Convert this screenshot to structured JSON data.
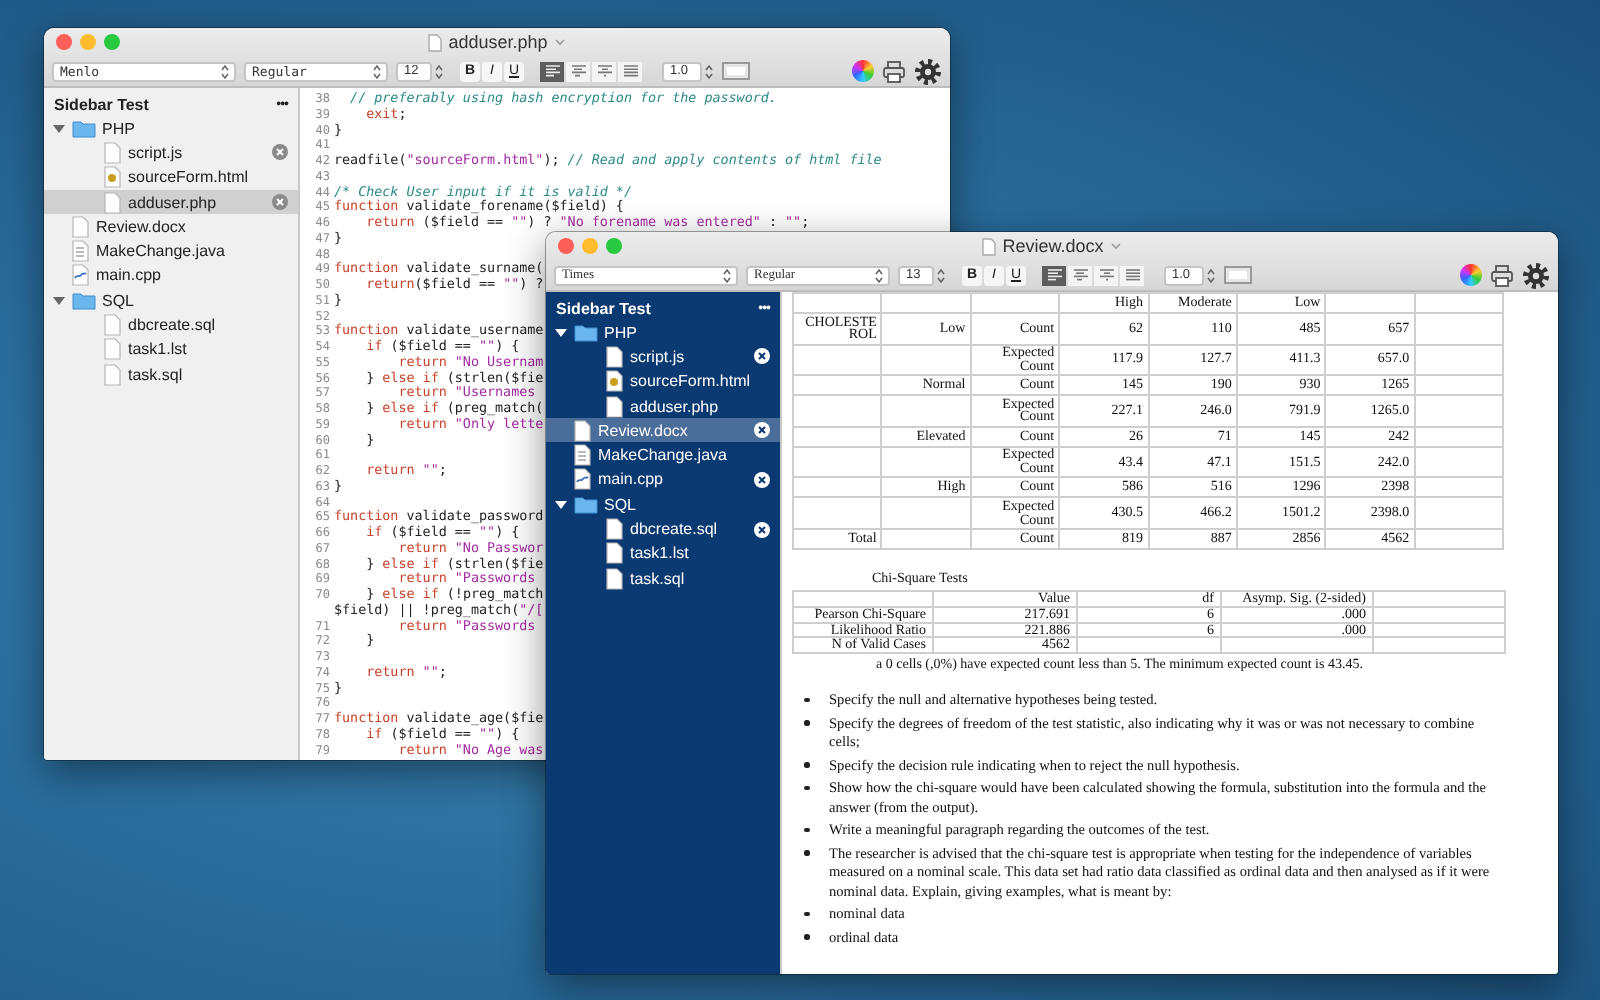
{
  "windows": [
    {
      "kind": "code",
      "title": "adduser.php",
      "toolbar": {
        "font": "Menlo",
        "style": "Regular",
        "size": "12",
        "format_buttons": [
          {
            "kind": "bold",
            "label": "B"
          },
          {
            "kind": "italic",
            "label": "I"
          },
          {
            "kind": "underline",
            "label": "U"
          }
        ],
        "align_buttons": [
          {
            "kind": "left",
            "selected": true
          },
          {
            "kind": "center",
            "selected": false
          },
          {
            "kind": "right",
            "selected": false
          },
          {
            "kind": "justify",
            "selected": false
          }
        ],
        "line_spacing": "1.0"
      },
      "sidebar": {
        "dark": false,
        "title": "Sidebar Test",
        "menu": "•••",
        "items": [
          {
            "name": "PHP",
            "kind": "folder",
            "expanded": true,
            "selected": false,
            "children": [
              {
                "name": "script.js",
                "kind": "file",
                "open": true,
                "selected": false
              },
              {
                "name": "sourceForm.html",
                "kind": "html",
                "open": false,
                "selected": false
              },
              {
                "name": "adduser.php",
                "kind": "file",
                "open": true,
                "selected": true
              }
            ]
          },
          {
            "name": "Review.docx",
            "kind": "file",
            "open": false,
            "selected": false
          },
          {
            "name": "MakeChange.java",
            "kind": "java",
            "open": false,
            "selected": false
          },
          {
            "name": "main.cpp",
            "kind": "cpp",
            "open": false,
            "selected": false
          },
          {
            "name": "SQL",
            "kind": "folder",
            "expanded": true,
            "selected": false,
            "children": [
              {
                "name": "dbcreate.sql",
                "kind": "file",
                "open": false,
                "selected": false
              },
              {
                "name": "task1.lst",
                "kind": "file",
                "open": false,
                "selected": false
              },
              {
                "name": "task.sql",
                "kind": "file",
                "open": false,
                "selected": false
              }
            ]
          }
        ]
      },
      "code": [
        {
          "number": "38",
          "tokens": [
            {
              "kind": "comment",
              "text": "  // preferably using hash encryption for the password."
            }
          ]
        },
        {
          "number": "39",
          "tokens": [
            {
              "kind": "keyword",
              "text": "    exit"
            },
            {
              "kind": "plain",
              "text": ";"
            }
          ]
        },
        {
          "number": "40",
          "tokens": [
            {
              "kind": "plain",
              "text": "}"
            }
          ]
        },
        {
          "number": "41"
        },
        {
          "number": "42",
          "tokens": [
            {
              "kind": "plain",
              "text": "readfile("
            },
            {
              "kind": "string",
              "text": "\"sourceForm.html\""
            },
            {
              "kind": "plain",
              "text": "); "
            },
            {
              "kind": "comment",
              "text": "// Read and apply contents of html file"
            }
          ]
        },
        {
          "number": "43"
        },
        {
          "number": "44",
          "tokens": [
            {
              "kind": "comment",
              "text": "/* Check User input if it is valid */"
            }
          ]
        },
        {
          "number": "45",
          "tokens": [
            {
              "kind": "keyword",
              "text": "function"
            },
            {
              "kind": "plain",
              "text": " validate_forename($field) {"
            }
          ]
        },
        {
          "number": "46",
          "tokens": [
            {
              "kind": "keyword",
              "text": "    return"
            },
            {
              "kind": "plain",
              "text": " ($field == "
            },
            {
              "kind": "string",
              "text": "\"\""
            },
            {
              "kind": "plain",
              "text": ") ? "
            },
            {
              "kind": "string",
              "text": "\"No forename was entered\""
            },
            {
              "kind": "plain",
              "text": " : "
            },
            {
              "kind": "string",
              "text": "\"\""
            },
            {
              "kind": "plain",
              "text": ";"
            }
          ]
        },
        {
          "number": "47",
          "tokens": [
            {
              "kind": "plain",
              "text": "}"
            }
          ]
        },
        {
          "number": "48"
        },
        {
          "number": "49",
          "tokens": [
            {
              "kind": "keyword",
              "text": "function"
            },
            {
              "kind": "plain",
              "text": " validate_surname("
            }
          ]
        },
        {
          "number": "50",
          "tokens": [
            {
              "kind": "keyword",
              "text": "    return"
            },
            {
              "kind": "plain",
              "text": "($field == "
            },
            {
              "kind": "string",
              "text": "\"\""
            },
            {
              "kind": "plain",
              "text": ") ?"
            }
          ]
        },
        {
          "number": "51",
          "tokens": [
            {
              "kind": "plain",
              "text": "}"
            }
          ]
        },
        {
          "number": "52"
        },
        {
          "number": "53",
          "tokens": [
            {
              "kind": "keyword",
              "text": "function"
            },
            {
              "kind": "plain",
              "text": " validate_username"
            }
          ]
        },
        {
          "number": "54",
          "tokens": [
            {
              "kind": "keyword",
              "text": "    if"
            },
            {
              "kind": "plain",
              "text": " ($field == "
            },
            {
              "kind": "string",
              "text": "\"\""
            },
            {
              "kind": "plain",
              "text": ") {"
            }
          ]
        },
        {
          "number": "55",
          "tokens": [
            {
              "kind": "keyword",
              "text": "        return"
            },
            {
              "kind": "string",
              "text": " \"No Usernam"
            }
          ]
        },
        {
          "number": "56",
          "tokens": [
            {
              "kind": "plain",
              "text": "    } "
            },
            {
              "kind": "keyword",
              "text": "else if"
            },
            {
              "kind": "plain",
              "text": " (strlen($fie"
            }
          ]
        },
        {
          "number": "57",
          "tokens": [
            {
              "kind": "keyword",
              "text": "        return"
            },
            {
              "kind": "string",
              "text": " \"Usernames"
            }
          ]
        },
        {
          "number": "58",
          "tokens": [
            {
              "kind": "plain",
              "text": "    } "
            },
            {
              "kind": "keyword",
              "text": "else if"
            },
            {
              "kind": "plain",
              "text": " (preg_match("
            }
          ]
        },
        {
          "number": "59",
          "tokens": [
            {
              "kind": "keyword",
              "text": "        return"
            },
            {
              "kind": "string",
              "text": " \"Only lette"
            }
          ]
        },
        {
          "number": "60",
          "tokens": [
            {
              "kind": "plain",
              "text": "    }"
            }
          ]
        },
        {
          "number": "61"
        },
        {
          "number": "62",
          "tokens": [
            {
              "kind": "keyword",
              "text": "    return"
            },
            {
              "kind": "string",
              "text": " \"\""
            },
            {
              "kind": "plain",
              "text": ";"
            }
          ]
        },
        {
          "number": "63",
          "tokens": [
            {
              "kind": "plain",
              "text": "}"
            }
          ]
        },
        {
          "number": "64"
        },
        {
          "number": "65",
          "tokens": [
            {
              "kind": "keyword",
              "text": "function"
            },
            {
              "kind": "plain",
              "text": " validate_password"
            }
          ]
        },
        {
          "number": "66",
          "tokens": [
            {
              "kind": "keyword",
              "text": "    if"
            },
            {
              "kind": "plain",
              "text": " ($field == "
            },
            {
              "kind": "string",
              "text": "\"\""
            },
            {
              "kind": "plain",
              "text": ") {"
            }
          ]
        },
        {
          "number": "67",
          "tokens": [
            {
              "kind": "keyword",
              "text": "        return"
            },
            {
              "kind": "string",
              "text": " \"No Passwor"
            }
          ]
        },
        {
          "number": "68",
          "tokens": [
            {
              "kind": "plain",
              "text": "    } "
            },
            {
              "kind": "keyword",
              "text": "else if"
            },
            {
              "kind": "plain",
              "text": " (strlen($fie"
            }
          ]
        },
        {
          "number": "69",
          "tokens": [
            {
              "kind": "keyword",
              "text": "        return"
            },
            {
              "kind": "string",
              "text": " \"Passwords"
            }
          ]
        },
        {
          "number": "70",
          "tokens": [
            {
              "kind": "plain",
              "text": "    } "
            },
            {
              "kind": "keyword",
              "text": "else if"
            },
            {
              "kind": "plain",
              "text": " (!preg_match"
            }
          ]
        },
        {
          "tokens": [
            {
              "kind": "plain",
              "text": "$field) || !preg_match("
            },
            {
              "kind": "string",
              "text": "\"/["
            }
          ]
        },
        {
          "number": "71",
          "tokens": [
            {
              "kind": "keyword",
              "text": "        return"
            },
            {
              "kind": "string",
              "text": " \"Passwords"
            }
          ]
        },
        {
          "number": "72",
          "tokens": [
            {
              "kind": "plain",
              "text": "    }"
            }
          ]
        },
        {
          "number": "73"
        },
        {
          "number": "74",
          "tokens": [
            {
              "kind": "keyword",
              "text": "    return"
            },
            {
              "kind": "string",
              "text": " \"\""
            },
            {
              "kind": "plain",
              "text": ";"
            }
          ]
        },
        {
          "number": "75",
          "tokens": [
            {
              "kind": "plain",
              "text": "}"
            }
          ]
        },
        {
          "number": "76"
        },
        {
          "number": "77",
          "tokens": [
            {
              "kind": "keyword",
              "text": "function"
            },
            {
              "kind": "plain",
              "text": " validate_age($fie"
            }
          ]
        },
        {
          "number": "78",
          "tokens": [
            {
              "kind": "keyword",
              "text": "    if"
            },
            {
              "kind": "plain",
              "text": " ($field == "
            },
            {
              "kind": "string",
              "text": "\"\""
            },
            {
              "kind": "plain",
              "text": ") {"
            }
          ]
        },
        {
          "number": "79",
          "tokens": [
            {
              "kind": "keyword",
              "text": "        return"
            },
            {
              "kind": "string",
              "text": " \"No Age was"
            }
          ]
        }
      ]
    },
    {
      "kind": "document",
      "title": "Review.docx",
      "toolbar": {
        "font": "Times",
        "style": "Regular",
        "size": "13",
        "format_buttons": [
          {
            "kind": "bold",
            "label": "B"
          },
          {
            "kind": "italic",
            "label": "I"
          },
          {
            "kind": "underline",
            "label": "U"
          }
        ],
        "align_buttons": [
          {
            "kind": "left",
            "selected": true
          },
          {
            "kind": "center",
            "selected": false
          },
          {
            "kind": "right",
            "selected": false
          },
          {
            "kind": "justify",
            "selected": false
          }
        ],
        "line_spacing": "1.0"
      },
      "sidebar": {
        "dark": true,
        "title": "Sidebar Test",
        "menu": "•••",
        "items": [
          {
            "name": "PHP",
            "kind": "folder",
            "expanded": true,
            "selected": false,
            "children": [
              {
                "name": "script.js",
                "kind": "file",
                "open": true,
                "selected": false
              },
              {
                "name": "sourceForm.html",
                "kind": "html",
                "open": false,
                "selected": false
              },
              {
                "name": "adduser.php",
                "kind": "file",
                "open": false,
                "selected": false
              }
            ]
          },
          {
            "name": "Review.docx",
            "kind": "file",
            "open": true,
            "selected": true
          },
          {
            "name": "MakeChange.java",
            "kind": "java",
            "open": false,
            "selected": false
          },
          {
            "name": "main.cpp",
            "kind": "cpp",
            "open": true,
            "selected": false
          },
          {
            "name": "SQL",
            "kind": "folder",
            "expanded": true,
            "selected": false,
            "children": [
              {
                "name": "dbcreate.sql",
                "kind": "file",
                "open": true,
                "selected": false
              },
              {
                "name": "task1.lst",
                "kind": "file",
                "open": false,
                "selected": false
              },
              {
                "name": "task.sql",
                "kind": "file",
                "open": false,
                "selected": false
              }
            ]
          }
        ]
      },
      "document": {
        "crosstab": {
          "value_headers": [
            "High",
            "Moderate",
            "Low"
          ],
          "rows": [
            [
              "CHOLESTE ROL",
              "Low",
              "Count",
              "62",
              "110",
              "485",
              "657",
              null
            ],
            [
              null,
              null,
              "Expected Count",
              "117.9",
              "127.7",
              "411.3",
              "657.0",
              null
            ],
            [
              null,
              "Normal",
              "Count",
              "145",
              "190",
              "930",
              "1265",
              null
            ],
            [
              null,
              null,
              "Expected Count",
              "227.1",
              "246.0",
              "791.9",
              "1265.0",
              null
            ],
            [
              null,
              "Elevated",
              "Count",
              "26",
              "71",
              "145",
              "242",
              null
            ],
            [
              null,
              null,
              "Expected Count",
              "43.4",
              "47.1",
              "151.5",
              "242.0",
              null
            ],
            [
              null,
              "High",
              "Count",
              "586",
              "516",
              "1296",
              "2398",
              null
            ],
            [
              null,
              null,
              "Expected Count",
              "430.5",
              "466.2",
              "1501.2",
              "2398.0",
              null
            ],
            [
              "Total",
              null,
              "Count",
              "819",
              "887",
              "2856",
              "4562",
              null
            ]
          ]
        },
        "chi_square": {
          "title": "Chi-Square Tests",
          "value_headers": [
            "Value",
            "df",
            "Asymp. Sig. (2-sided)"
          ],
          "rows": [
            [
              "Pearson Chi-Square",
              "217.691",
              "6",
              ".000",
              null
            ],
            [
              "Likelihood Ratio",
              "221.886",
              "6",
              ".000",
              null
            ],
            [
              "N of Valid Cases",
              "4562",
              null,
              null,
              null
            ]
          ],
          "footnote": "a 0 cells (,0%) have expected count less than 5. The minimum expected count is 43.45."
        },
        "bullets": [
          "Specify the null and alternative hypotheses being tested.",
          "Specify the degrees of freedom of the test statistic, also indicating why it was or was not necessary to combine cells;",
          "Specify the decision rule indicating when to reject the null hypothesis.",
          "Show how the chi-square would have been calculated showing the formula,  substitution into the formula and the answer (from the output).",
          "Write a meaningful paragraph regarding the outcomes of the test.",
          "The researcher is advised that the chi-square test is appropriate when testing for the independence of variables measured on a nominal scale. This data set had ratio data classified as ordinal data and then analysed as if it were nominal data. Explain, giving examples, what is meant by:",
          "nominal data",
          "ordinal data"
        ]
      }
    }
  ]
}
